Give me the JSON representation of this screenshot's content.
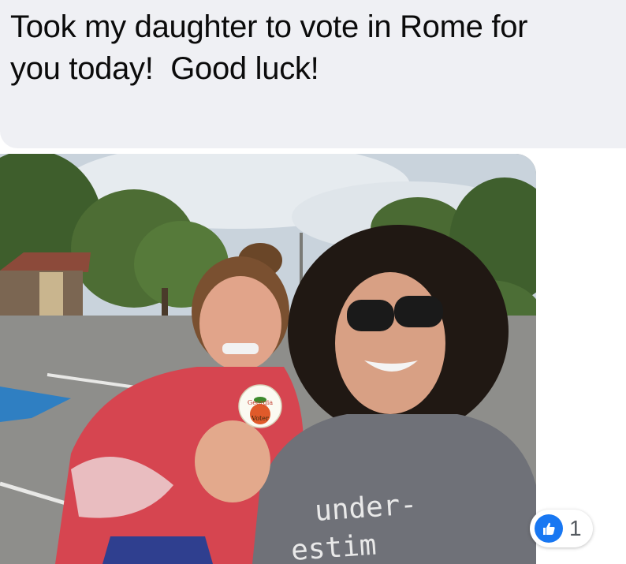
{
  "post": {
    "text": "Took my daughter to vote in Rome for\nyou today!  Good luck!"
  },
  "photo": {
    "sticker_text_line1": "Georgia",
    "sticker_text_line2": "Voter",
    "shirt_text_line1": "under-",
    "shirt_text_line2": "estim"
  },
  "reactions": {
    "icon": "like-thumbs-up-icon",
    "count": "1",
    "color": "#1877f2"
  }
}
